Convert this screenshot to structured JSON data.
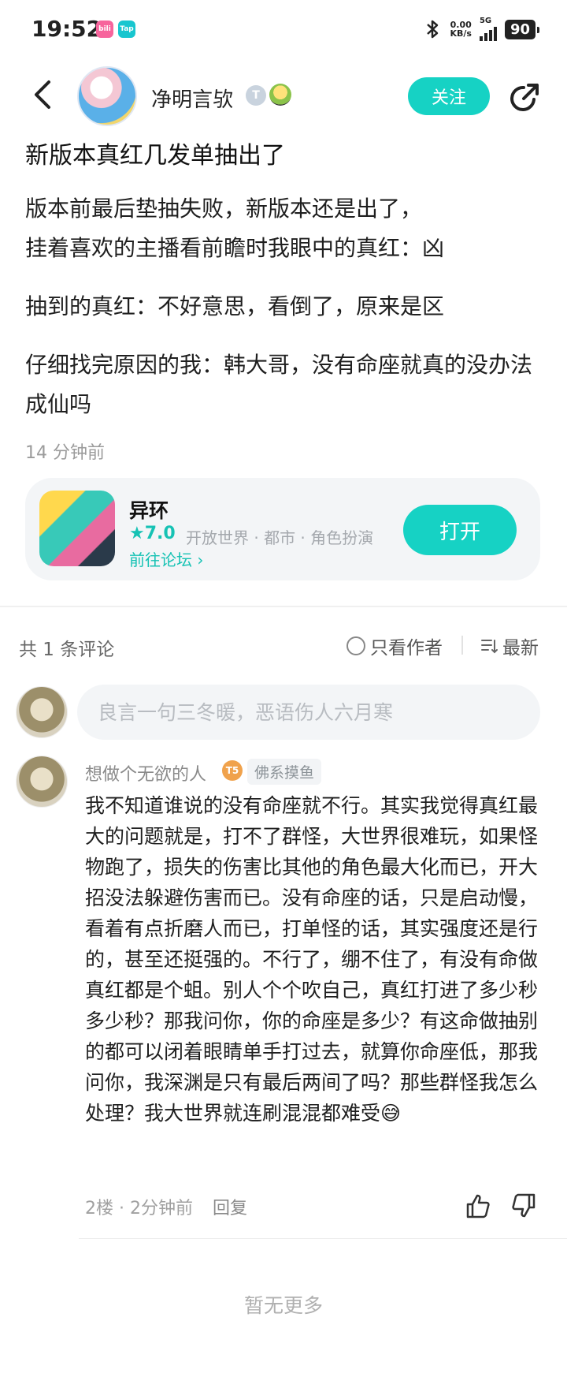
{
  "status_bar": {
    "time": "19:52",
    "app_badge_1": "bilibili",
    "app_badge_2": "Tap",
    "net_speed_value": "0.00",
    "net_speed_unit": "KB/s",
    "network": "5G",
    "battery": "90"
  },
  "header": {
    "username": "净明言欤",
    "level_badge": "T",
    "follow_label": "关注"
  },
  "post": {
    "title": "新版本真红几发单抽出了",
    "paragraphs": [
      "版本前最后垫抽失败，新版本还是出了，\n挂着喜欢的主播看前瞻时我眼中的真红：凶",
      "抽到的真红：不好意思，看倒了，原来是区",
      "仔细找完原因的我：韩大哥，没有命座就真的没办法成仙吗"
    ],
    "time": "14 分钟前"
  },
  "game_card": {
    "name": "异环",
    "rating": "★7.0",
    "tags": "开放世界 · 都市 · 角色扮演",
    "forum_link": "前往论坛 ›",
    "open_label": "打开"
  },
  "comments_header": {
    "count": "共 1 条评论",
    "author_only": "只看作者",
    "sort": "最新"
  },
  "comment_input": {
    "placeholder": "良言一句三冬暖，恶语伤人六月寒"
  },
  "comment": {
    "author": "想做个无欲的人",
    "level": "T5",
    "tag": "佛系摸鱼",
    "text": "我不知道谁说的没有命座就不行。其实我觉得真红最大的问题就是，打不了群怪，大世界很难玩，如果怪物跑了，损失的伤害比其他的角色最大化而已，开大招没法躲避伤害而已。没有命座的话，只是启动慢，看着有点折磨人而已，打单怪的话，其实强度还是行的，甚至还挺强的。不行了，绷不住了，有没有命做真红都是个蛆。别人个个吹自己，真红打进了多少秒多少秒？那我问你，你的命座是多少？有这命做抽别的都可以闭着眼睛单手打过去，就算你命座低，那我问你，我深渊是只有最后两间了吗？那些群怪我怎么处理？我大世界就连刷混混都难受😅",
    "meta": "2楼 · 2分钟前",
    "reply_label": "回复"
  },
  "footer": {
    "no_more": "暂无更多"
  },
  "colors": {
    "accent": "#16d2c4",
    "text": "#1f1f1f",
    "muted": "#9b9b9b",
    "card_bg": "#f3f5f7"
  }
}
